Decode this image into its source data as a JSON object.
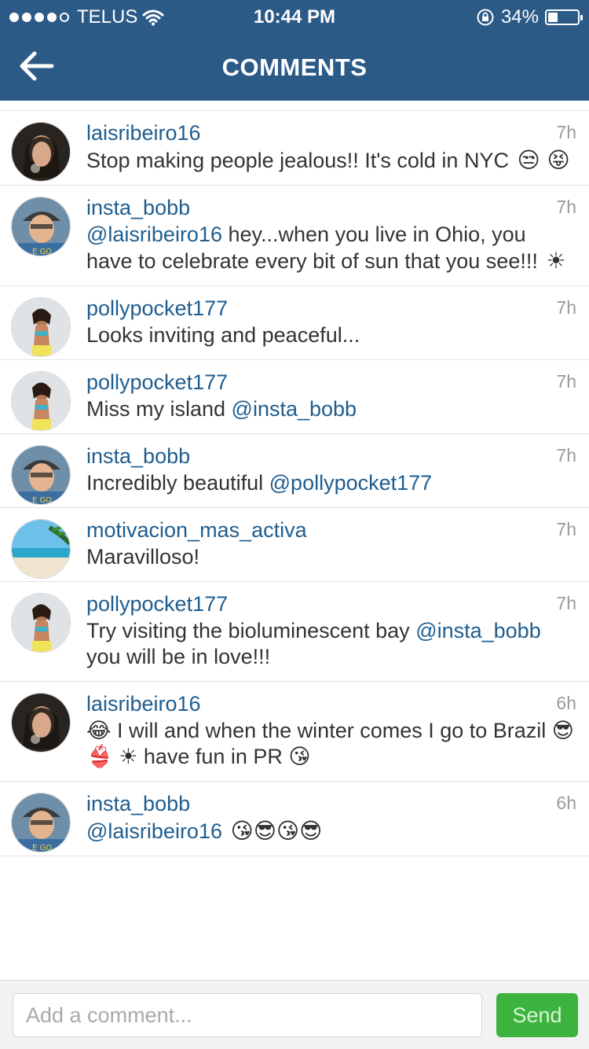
{
  "status_bar": {
    "carrier": "TELUS",
    "time": "10:44 PM",
    "battery_percent_label": "34%",
    "battery_level": 0.34
  },
  "nav": {
    "title": "COMMENTS"
  },
  "comments": [
    {
      "user": "laisribeiro16",
      "time": "7h",
      "avatar": "laisribeiro16-avatar",
      "text_parts": [
        {
          "t": "Stop making people jealous!! It's cold in NYC ",
          "m": false
        }
      ],
      "emojis_after": "😒 😝"
    },
    {
      "user": "insta_bobb",
      "time": "7h",
      "avatar": "insta-bobb-avatar",
      "text_parts": [
        {
          "t": "@laisribeiro16",
          "m": true
        },
        {
          "t": " hey...when you live in Ohio, you have to celebrate every bit of sun that you see!!! ",
          "m": false
        }
      ],
      "emojis_after": "☀"
    },
    {
      "user": "pollypocket177",
      "time": "7h",
      "avatar": "pollypocket177-avatar",
      "text_parts": [
        {
          "t": "Looks inviting and peaceful...",
          "m": false
        }
      ],
      "emojis_after": ""
    },
    {
      "user": "pollypocket177",
      "time": "7h",
      "avatar": "pollypocket177-avatar",
      "text_parts": [
        {
          "t": "Miss my island ",
          "m": false
        },
        {
          "t": "@insta_bobb",
          "m": true
        }
      ],
      "emojis_after": ""
    },
    {
      "user": "insta_bobb",
      "time": "7h",
      "avatar": "insta-bobb-avatar",
      "text_parts": [
        {
          "t": "Incredibly beautiful ",
          "m": false
        },
        {
          "t": "@pollypocket177",
          "m": true
        }
      ],
      "emojis_after": ""
    },
    {
      "user": "motivacion_mas_activa",
      "time": "7h",
      "avatar": "beach-avatar",
      "text_parts": [
        {
          "t": "Maravilloso!",
          "m": false
        }
      ],
      "emojis_after": ""
    },
    {
      "user": "pollypocket177",
      "time": "7h",
      "avatar": "pollypocket177-avatar",
      "text_parts": [
        {
          "t": "Try visiting the bioluminescent bay ",
          "m": false
        },
        {
          "t": "@insta_bobb",
          "m": true
        },
        {
          "t": " you will be in love!!!",
          "m": false
        }
      ],
      "emojis_after": ""
    },
    {
      "user": "laisribeiro16",
      "time": "6h",
      "avatar": "laisribeiro16-avatar",
      "text_parts": [
        {
          "t": "😂 I will and when the winter comes I go to Brazil 😎 👙 ☀ have fun in PR 😘",
          "m": false
        }
      ],
      "emojis_after": ""
    },
    {
      "user": "insta_bobb",
      "time": "6h",
      "avatar": "insta-bobb-avatar",
      "text_parts": [
        {
          "t": "@laisribeiro16",
          "m": true
        },
        {
          "t": " ",
          "m": false
        }
      ],
      "emojis_after": "😘😎😘😎"
    }
  ],
  "compose": {
    "placeholder": "Add a comment...",
    "send_label": "Send"
  },
  "colors": {
    "header_bg": "#2b5a87",
    "username": "#1f5d8f",
    "send_button": "#3db33f"
  }
}
